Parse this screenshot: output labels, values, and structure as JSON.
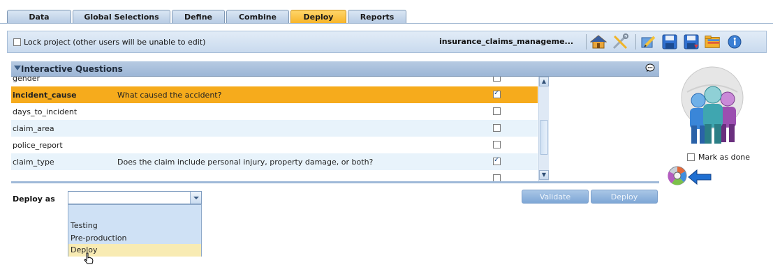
{
  "tabs": [
    "Data",
    "Global Selections",
    "Define",
    "Combine",
    "Deploy",
    "Reports"
  ],
  "active_tab": "Deploy",
  "toolbar": {
    "lock_label": "Lock project (other users will be unable to edit)",
    "project_name": "insurance_claims_manageme..."
  },
  "panel": {
    "title": "Interactive Questions"
  },
  "rows": [
    {
      "name": "gender",
      "question": "",
      "checked": false
    },
    {
      "name": "incident_cause",
      "question": "What caused the accident?",
      "checked": true
    },
    {
      "name": "days_to_incident",
      "question": "",
      "checked": false
    },
    {
      "name": "claim_area",
      "question": "",
      "checked": false
    },
    {
      "name": "police_report",
      "question": "",
      "checked": false
    },
    {
      "name": "claim_type",
      "question": "Does the claim include personal injury, property damage, or both?",
      "checked": true
    },
    {
      "name": "",
      "question": "",
      "checked": false
    }
  ],
  "selected_row": 1,
  "mark_done": {
    "label": "Mark as done",
    "checked": false
  },
  "deploy": {
    "label": "Deploy as",
    "value": "",
    "options": [
      "",
      "Testing",
      "Pre-production",
      "Deploy"
    ],
    "highlighted_option": 3
  },
  "buttons": {
    "validate": "Validate",
    "deploy": "Deploy"
  },
  "colors": {
    "accent": "#f6ab1c",
    "panel_header": "#9cb6d6",
    "alt_row": "#e8f3fb"
  },
  "icons": [
    "home-icon",
    "tools-icon",
    "edit-icon",
    "save-icon",
    "save-as-icon",
    "open-folder-icon",
    "info-icon",
    "comment-icon"
  ]
}
